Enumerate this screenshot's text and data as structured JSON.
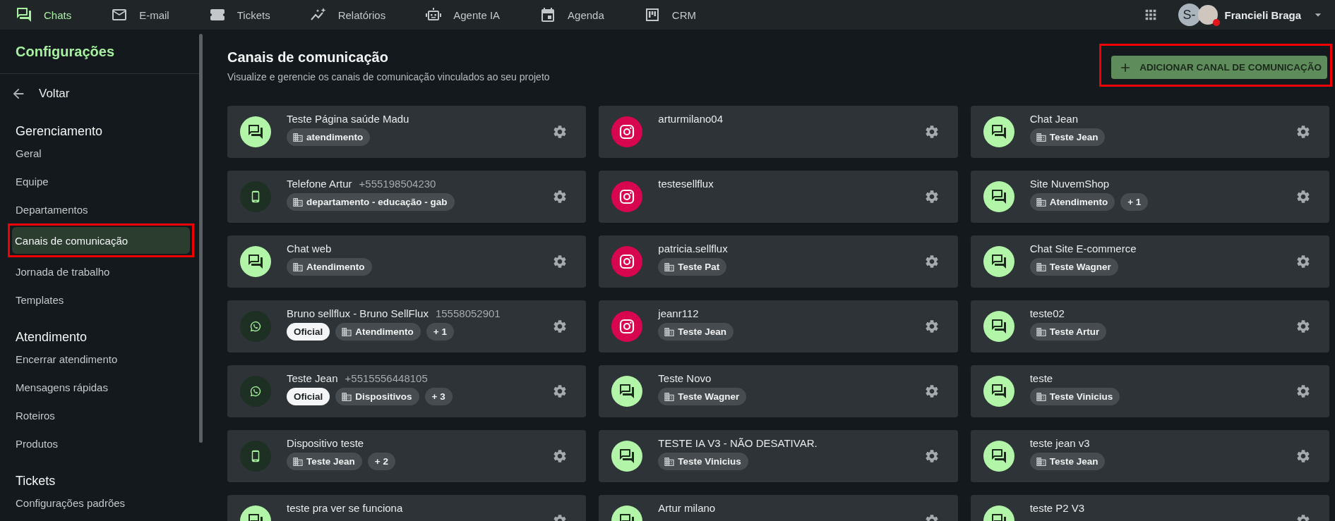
{
  "top_nav": {
    "items": [
      {
        "label": "Chats",
        "selected": true
      },
      {
        "label": "E-mail",
        "selected": false
      },
      {
        "label": "Tickets",
        "selected": false
      },
      {
        "label": "Relatórios",
        "selected": false
      },
      {
        "label": "Agente IA",
        "selected": false
      },
      {
        "label": "Agenda",
        "selected": false
      },
      {
        "label": "CRM",
        "selected": false
      }
    ]
  },
  "user": {
    "initials": "S-",
    "name": "Francieli Braga",
    "busy": true
  },
  "sidebar": {
    "title": "Configurações",
    "back": "Voltar",
    "sections": [
      {
        "heading": "Gerenciamento",
        "items": [
          {
            "label": "Geral",
            "selected": false,
            "annotated": false
          },
          {
            "label": "Equipe",
            "selected": false,
            "annotated": false
          },
          {
            "label": "Departamentos",
            "selected": false,
            "annotated": false
          },
          {
            "label": "Canais de comunicação",
            "selected": true,
            "annotated": true
          },
          {
            "label": "Jornada de trabalho",
            "selected": false,
            "annotated": false
          },
          {
            "label": "Templates",
            "selected": false,
            "annotated": false
          }
        ]
      },
      {
        "heading": "Atendimento",
        "items": [
          {
            "label": "Encerrar atendimento",
            "selected": false,
            "annotated": false
          },
          {
            "label": "Mensagens rápidas",
            "selected": false,
            "annotated": false
          },
          {
            "label": "Roteiros",
            "selected": false,
            "annotated": false
          },
          {
            "label": "Produtos",
            "selected": false,
            "annotated": false
          }
        ]
      },
      {
        "heading": "Tickets",
        "items": [
          {
            "label": "Configurações padrões",
            "selected": false,
            "annotated": false
          }
        ]
      }
    ]
  },
  "main": {
    "title": "Canais de comunicação",
    "subtitle": "Visualize e gerencie os canais de comunicação vinculados ao seu projeto",
    "add_button": {
      "label": "ADICIONAR CANAL DE COMUNICAÇÃO",
      "annotated": true
    },
    "channels": [
      {
        "kind": "chat",
        "title": "Teste Página saúde Madu",
        "tags": [
          {
            "kind": "department",
            "label": "atendimento"
          }
        ]
      },
      {
        "kind": "instagram",
        "title": "arturmilano04"
      },
      {
        "kind": "chat",
        "title": "Chat Jean",
        "tags": [
          {
            "kind": "department",
            "label": "Teste Jean"
          }
        ]
      },
      {
        "kind": "phone",
        "title": "Telefone Artur",
        "number": "+555198504230",
        "tags": [
          {
            "kind": "department",
            "label": "departamento - educação - gab"
          }
        ]
      },
      {
        "kind": "instagram",
        "title": "testesellflux"
      },
      {
        "kind": "chat",
        "title": "Site NuvemShop",
        "tags": [
          {
            "kind": "department",
            "label": "Atendimento"
          },
          {
            "kind": "more",
            "label": "+ 1"
          }
        ]
      },
      {
        "kind": "chat",
        "title": "Chat web",
        "tags": [
          {
            "kind": "department",
            "label": "Atendimento"
          }
        ]
      },
      {
        "kind": "instagram",
        "title": "patricia.sellflux",
        "tags": [
          {
            "kind": "department",
            "label": "Teste Pat"
          }
        ]
      },
      {
        "kind": "chat",
        "title": "Chat Site E-commerce",
        "tags": [
          {
            "kind": "department",
            "label": "Teste Wagner"
          }
        ]
      },
      {
        "kind": "whatsapp",
        "title": "Bruno sellflux - Bruno SellFlux",
        "number": "15558052901",
        "tags": [
          {
            "kind": "official",
            "label": "Oficial"
          },
          {
            "kind": "department",
            "label": "Atendimento"
          },
          {
            "kind": "more",
            "label": "+ 1"
          }
        ]
      },
      {
        "kind": "instagram",
        "title": "jeanr112",
        "tags": [
          {
            "kind": "department",
            "label": "Teste Jean"
          }
        ]
      },
      {
        "kind": "chat",
        "title": "teste02",
        "tags": [
          {
            "kind": "department",
            "label": "Teste Artur"
          }
        ]
      },
      {
        "kind": "whatsapp",
        "title": "Teste Jean",
        "number": "+5515556448105",
        "tags": [
          {
            "kind": "official",
            "label": "Oficial"
          },
          {
            "kind": "department",
            "label": "Dispositivos"
          },
          {
            "kind": "more",
            "label": "+ 3"
          }
        ]
      },
      {
        "kind": "chat",
        "title": "Teste Novo",
        "tags": [
          {
            "kind": "department",
            "label": "Teste Wagner"
          }
        ]
      },
      {
        "kind": "chat",
        "title": "teste",
        "tags": [
          {
            "kind": "department",
            "label": "Teste Vinicius"
          }
        ]
      },
      {
        "kind": "phone",
        "title": "Dispositivo teste",
        "tags": [
          {
            "kind": "department",
            "label": "Teste Jean"
          },
          {
            "kind": "more",
            "label": "+ 2"
          }
        ]
      },
      {
        "kind": "chat",
        "title": "TESTE IA V3 - NÃO DESATIVAR.",
        "tags": [
          {
            "kind": "department",
            "label": "Teste Vinicius"
          }
        ]
      },
      {
        "kind": "chat",
        "title": "teste jean v3",
        "tags": [
          {
            "kind": "department",
            "label": "Teste Jean"
          }
        ]
      },
      {
        "kind": "chat",
        "title": "teste pra ver se funciona"
      },
      {
        "kind": "chat",
        "title": "Artur milano"
      },
      {
        "kind": "chat",
        "title": "teste P2 V3"
      }
    ]
  }
}
